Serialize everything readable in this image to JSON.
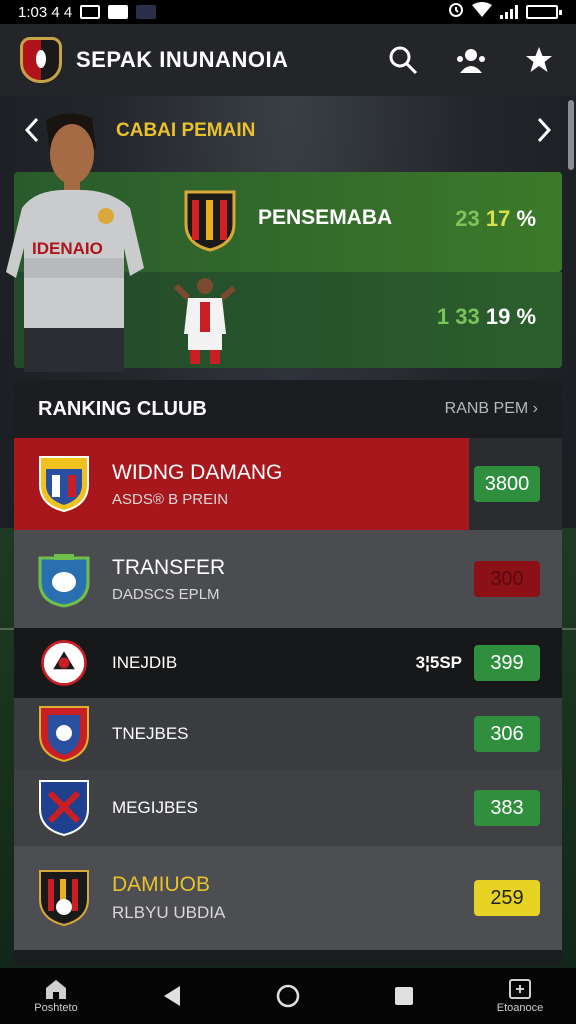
{
  "status_bar": {
    "time": "1:03 4 4",
    "icons": [
      "alarm-icon",
      "wifi-icon",
      "signal-icon",
      "battery-icon"
    ]
  },
  "app_bar": {
    "title": "SEPAK INUNANOIA",
    "actions": [
      "search-icon",
      "community-icon",
      "favorite-icon"
    ]
  },
  "featured": {
    "title": "CABAI PEMAIN",
    "shirt_text": "IDENAIO",
    "matches": [
      {
        "club": "PENSEMABA",
        "stat_a": "23",
        "stat_b": "17",
        "unit": "%"
      },
      {
        "club": "",
        "stat_a": "1 33",
        "stat_b": "19",
        "unit": "%"
      }
    ]
  },
  "ranking": {
    "title": "RANKING CLUUB",
    "more_label": "RANB PEM",
    "rows": [
      {
        "name": "WIDNG DAMANG",
        "sub": "ASDS® B PREIN",
        "score": "3800",
        "score_style": "green",
        "extra": ""
      },
      {
        "name": "TRANSFER",
        "sub": "DADSCS EPLM",
        "score": "300",
        "score_style": "red",
        "extra": ""
      },
      {
        "name": "INEJDIB",
        "sub": "",
        "score": "399",
        "score_style": "green",
        "extra": "3¦5SP"
      },
      {
        "name": "TNEJBES",
        "sub": "",
        "score": "306",
        "score_style": "green",
        "extra": ""
      },
      {
        "name": "MEGIJBES",
        "sub": "",
        "score": "383",
        "score_style": "green",
        "extra": ""
      },
      {
        "name": "DAMIUOB",
        "sub": "RLBYU UBDIA",
        "score": "259",
        "score_style": "yellow",
        "extra": ""
      }
    ]
  },
  "nav_bar": {
    "left_label": "Poshteto",
    "right_label": "Etoanoce"
  },
  "colors": {
    "accent": "#e8c12c",
    "green": "#2f8f3e",
    "red": "#b0141a",
    "yellow": "#e7d323"
  }
}
